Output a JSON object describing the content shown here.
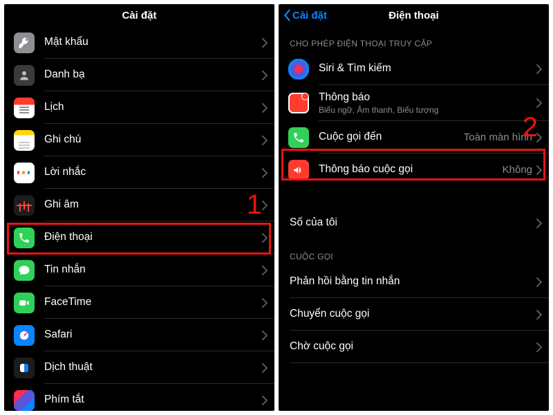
{
  "colors": {
    "accent_blue": "#0a84ff",
    "highlight_red": "#e11414"
  },
  "annotations": {
    "step1": "1",
    "step2": "2"
  },
  "left": {
    "title": "Cài đặt",
    "items": [
      {
        "key": "passwords",
        "label": "Mật khẩu"
      },
      {
        "key": "contacts",
        "label": "Danh bạ"
      },
      {
        "key": "calendar",
        "label": "Lịch"
      },
      {
        "key": "notes",
        "label": "Ghi chú"
      },
      {
        "key": "reminders",
        "label": "Lời nhắc"
      },
      {
        "key": "voicememos",
        "label": "Ghi âm"
      },
      {
        "key": "phone",
        "label": "Điện thoại"
      },
      {
        "key": "messages",
        "label": "Tin nhắn"
      },
      {
        "key": "facetime",
        "label": "FaceTime"
      },
      {
        "key": "safari",
        "label": "Safari"
      },
      {
        "key": "translate",
        "label": "Dịch thuật"
      },
      {
        "key": "shortcuts",
        "label": "Phím tắt"
      }
    ]
  },
  "right": {
    "back_label": "Cài đặt",
    "title": "Điện thoại",
    "section_allow": "CHO PHÉP ĐIỆN THOẠI TRUY CẬP",
    "siri_label": "Siri & Tìm kiếm",
    "notifications_label": "Thông báo",
    "notifications_sub": "Biểu ngữ, Âm thanh, Biểu tượng",
    "incoming_label": "Cuộc gọi đến",
    "incoming_value": "Toàn màn hình",
    "announce_label": "Thông báo cuộc gọi",
    "announce_value": "Không",
    "my_number_label": "Số của tôi",
    "section_calls": "CUỘC GỌI",
    "respond_label": "Phản hồi bằng tin nhắn",
    "forward_label": "Chuyển cuộc gọi",
    "waiting_label": "Chờ cuộc gọi"
  }
}
